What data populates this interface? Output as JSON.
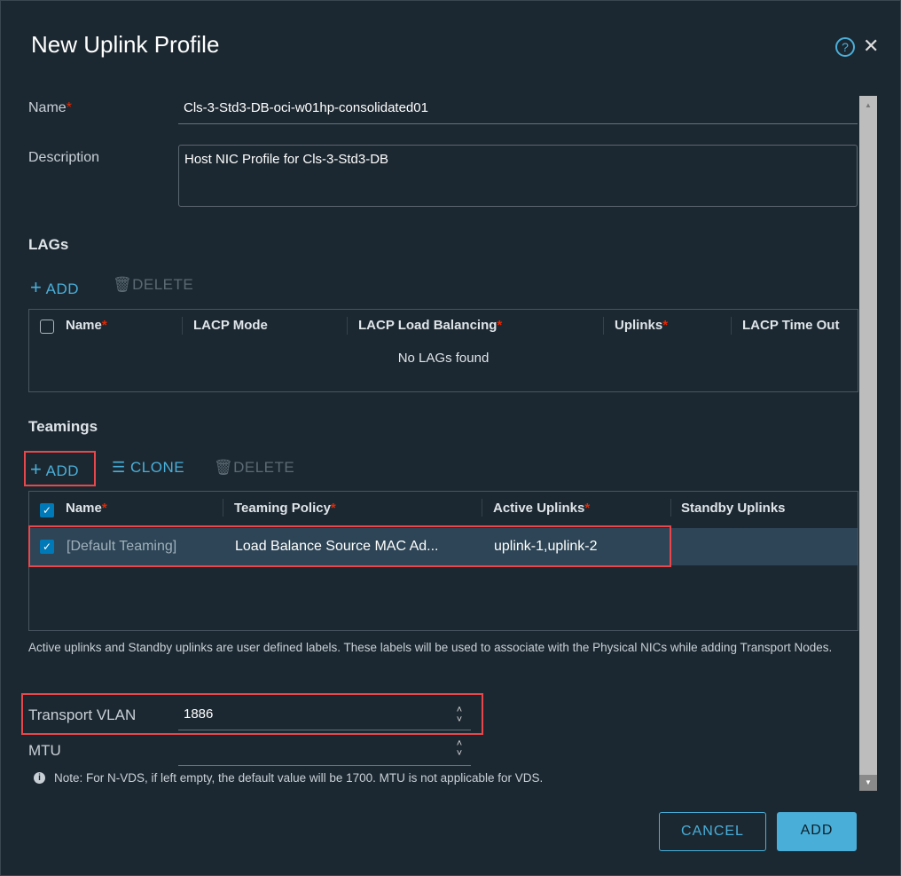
{
  "dialog": {
    "title": "New Uplink Profile"
  },
  "form": {
    "name_label": "Name",
    "name_value": "Cls-3-Std3-DB-oci-w01hp-consolidated01",
    "description_label": "Description",
    "description_value": "Host NIC Profile for Cls-3-Std3-DB",
    "required_mark": "*"
  },
  "lags": {
    "title": "LAGs",
    "add_label": "ADD",
    "delete_label": "DELETE",
    "columns": [
      "Name",
      "LACP Mode",
      "LACP Load Balancing",
      "Uplinks",
      "LACP Time Out"
    ],
    "empty_text": "No LAGs found"
  },
  "teamings": {
    "title": "Teamings",
    "add_label": "ADD",
    "clone_label": "CLONE",
    "delete_label": "DELETE",
    "columns": [
      "Name",
      "Teaming Policy",
      "Active Uplinks",
      "Standby Uplinks"
    ],
    "rows": [
      {
        "name": "[Default Teaming]",
        "policy": "Load Balance Source MAC Ad...",
        "active": "uplink-1,uplink-2",
        "standby": "",
        "selected": true
      }
    ],
    "help_text": "Active uplinks and Standby uplinks are user defined labels. These labels will be used to associate with the Physical NICs while adding Transport Nodes."
  },
  "transport_vlan": {
    "label": "Transport VLAN",
    "value": "1886"
  },
  "mtu": {
    "label": "MTU",
    "value": "",
    "note": "Note: For N-VDS, if left empty, the default value will be 1700. MTU is not applicable for VDS."
  },
  "footer": {
    "cancel_label": "CANCEL",
    "add_label": "ADD"
  },
  "colors": {
    "accent": "#49afd9",
    "primary_button": "#49afd9",
    "highlight": "#e8474b",
    "background": "#1c2831"
  }
}
